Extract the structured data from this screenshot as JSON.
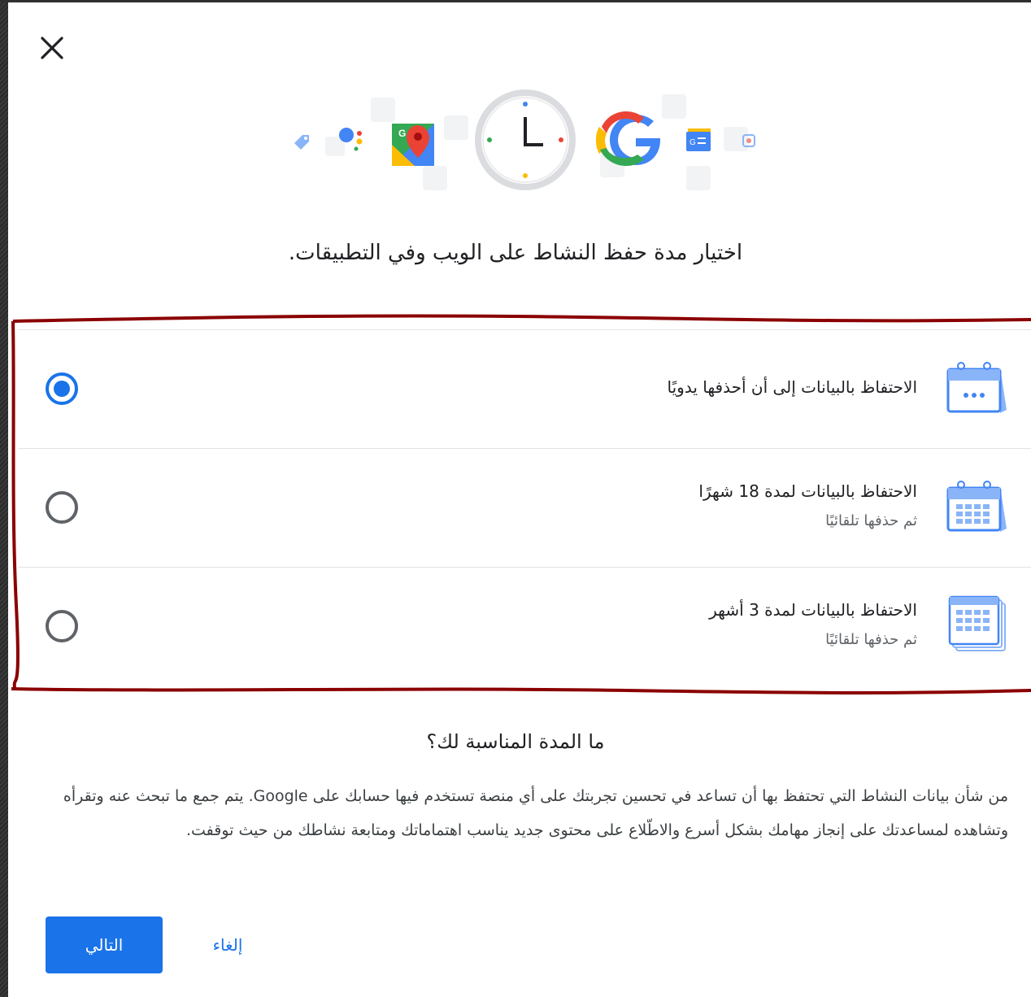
{
  "dialog": {
    "title": "اختيار مدة حفظ النشاط على الويب وفي التطبيقات."
  },
  "options": [
    {
      "main": "الاحتفاظ بالبيانات إلى أن أحذفها يدويًا",
      "sub": "",
      "selected": true,
      "icon": "calendar-dots-icon"
    },
    {
      "main": "الاحتفاظ بالبيانات لمدة 18 شهرًا",
      "sub": "ثم حذفها تلقائيًا",
      "selected": false,
      "icon": "calendar-grid-icon"
    },
    {
      "main": "الاحتفاظ بالبيانات لمدة 3 أشهر",
      "sub": "ثم حذفها تلقائيًا",
      "selected": false,
      "icon": "calendar-stack-icon"
    }
  ],
  "help": {
    "title": "ما المدة المناسبة لك؟",
    "body": "من شأن بيانات النشاط التي تحتفظ بها أن تساعد في تحسين تجربتك على أي منصة تستخدم فيها حسابك على Google. يتم جمع ما تبحث عنه وتقرأه وتشاهده لمساعدتك على إنجاز مهامك بشكل أسرع والاطّلاع على محتوى جديد يناسب اهتماماتك ومتابعة نشاطك من حيث توقفت."
  },
  "buttons": {
    "next": "التالي",
    "cancel": "إلغاء"
  },
  "colors": {
    "accent": "#1a73e8",
    "annotation": "#8b0000"
  },
  "icons": {
    "close": "close-icon",
    "hero": "clock-and-google-apps-icon"
  }
}
